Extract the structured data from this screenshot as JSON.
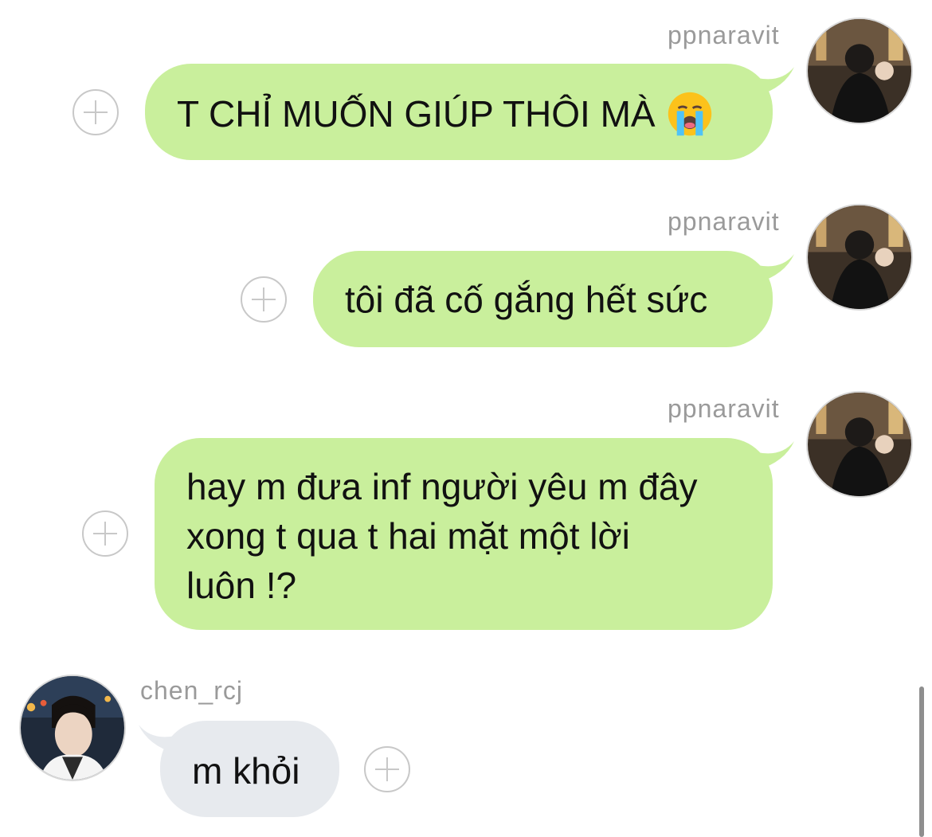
{
  "messages": [
    {
      "sender": "ppnaravit",
      "direction": "outgoing",
      "text": "T CHỈ MUỐN GIÚP THÔI MÀ",
      "emoji_icon": "loudly-crying-face-icon"
    },
    {
      "sender": "ppnaravit",
      "direction": "outgoing",
      "text": "tôi đã cố gắng hết sức"
    },
    {
      "sender": "ppnaravit",
      "direction": "outgoing",
      "lines": [
        "hay m đưa inf người yêu m đây",
        "xong t qua t hai mặt một lời",
        "luôn !?"
      ]
    },
    {
      "sender": "chen_rcj",
      "direction": "incoming",
      "text": "m khỏi"
    }
  ],
  "colors": {
    "outgoing_bubble": "#c9ef9c",
    "incoming_bubble": "#e7eaee",
    "username": "#9a9a9a",
    "plus_button": "#c8c8c8"
  },
  "icons": {
    "reaction_button": "plus-circle-icon",
    "avatar": "avatar"
  }
}
